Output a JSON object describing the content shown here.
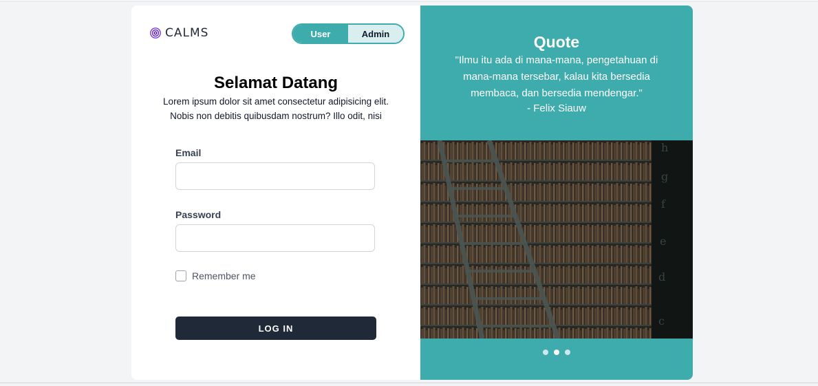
{
  "brand": {
    "name": "CALMS"
  },
  "role_toggle": {
    "options": [
      {
        "label": "User",
        "active": true
      },
      {
        "label": "Admin",
        "active": false
      }
    ],
    "accent_color": "#3eabac"
  },
  "welcome": {
    "title": "Selamat Datang",
    "subtitle_line1": "Lorem ipsum dolor sit amet consectetur adipisicing elit.",
    "subtitle_line2": "Nobis non debitis quibusdam nostrum? Illo odit, nisi"
  },
  "form": {
    "email_label": "Email",
    "email_value": "",
    "password_label": "Password",
    "password_value": "",
    "remember_label": "Remember me",
    "remember_checked": false,
    "login_label": "LOG IN"
  },
  "quote": {
    "title": "Quote",
    "text": "\"Ilmu itu ada di mana-mana, pengetahuan di mana-mana tersebar, kalau kita bersedia membaca, dan bersedia mendengar.\"",
    "author": "- Felix Siauw"
  },
  "carousel": {
    "image_icon": "library-bookshelf-image",
    "slide_count": 3,
    "active_index": 1
  },
  "colors": {
    "panel": "#3eabac",
    "button": "#1f2937",
    "background": "#f3f4f6"
  }
}
